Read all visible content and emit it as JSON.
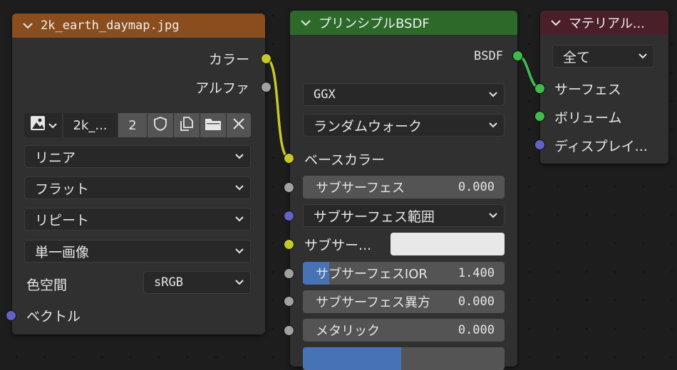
{
  "image_node": {
    "title": "2k_earth_daymap.jpg",
    "outputs": {
      "color": "カラー",
      "alpha": "アルファ"
    },
    "image_block": {
      "name": "2k_...",
      "users": "2"
    },
    "interpolation": "リニア",
    "projection": "フラット",
    "extension": "リピート",
    "source": "単一画像",
    "color_space_label": "色空間",
    "color_space_value": "sRGB",
    "vector_input": "ベクトル",
    "header_color": "#8a4d1e"
  },
  "principled_node": {
    "title": "プリンシプルBSDF",
    "output": "BSDF",
    "distribution": "GGX",
    "subsurface_method": "ランダムウォーク",
    "base_color": "ベースカラー",
    "subsurface": {
      "label": "サブサーフェス",
      "value": "0.000"
    },
    "subsurface_radius": "サブサーフェス範囲",
    "subsurface_color": "サブサー...",
    "subsurface_ior": {
      "label": "サブサーフェスIOR",
      "value": "1.400",
      "fill_fraction": 0.13
    },
    "subsurface_aniso": {
      "label": "サブサーフェス異方",
      "value": "0.000"
    },
    "metallic": {
      "label": "メタリック",
      "value": "0.000"
    },
    "header_color": "#2d6a2a"
  },
  "material_output_node": {
    "title": "マテリアル...",
    "target": "全て",
    "surface": "サーフェス",
    "volume": "ボリューム",
    "displacement": "ディスプレイ...",
    "header_color": "#4b1f2a"
  }
}
